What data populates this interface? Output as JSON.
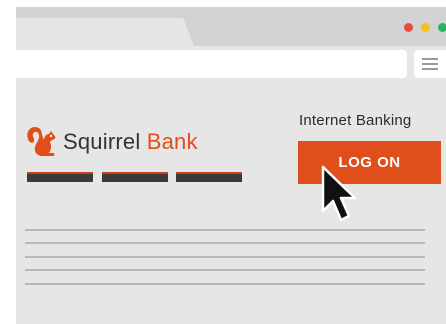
{
  "window": {
    "controls": [
      "close",
      "minimize",
      "maximize"
    ],
    "colors": {
      "close": "#e84b3c",
      "minimize": "#f4c21d",
      "maximize": "#2eb25a"
    }
  },
  "toolbar": {
    "menu_icon": "hamburger-menu-icon"
  },
  "site": {
    "brand_part1": "Squirrel",
    "brand_part2": "Bank",
    "logo_icon": "squirrel-icon",
    "brand_color": "#e04e1b",
    "nav_items_count_visible": 3
  },
  "banking": {
    "label": "Internet Banking",
    "logon_label": "LOG ON",
    "logon_color": "#e04e1b"
  },
  "cursor_icon": "mouse-pointer-icon"
}
